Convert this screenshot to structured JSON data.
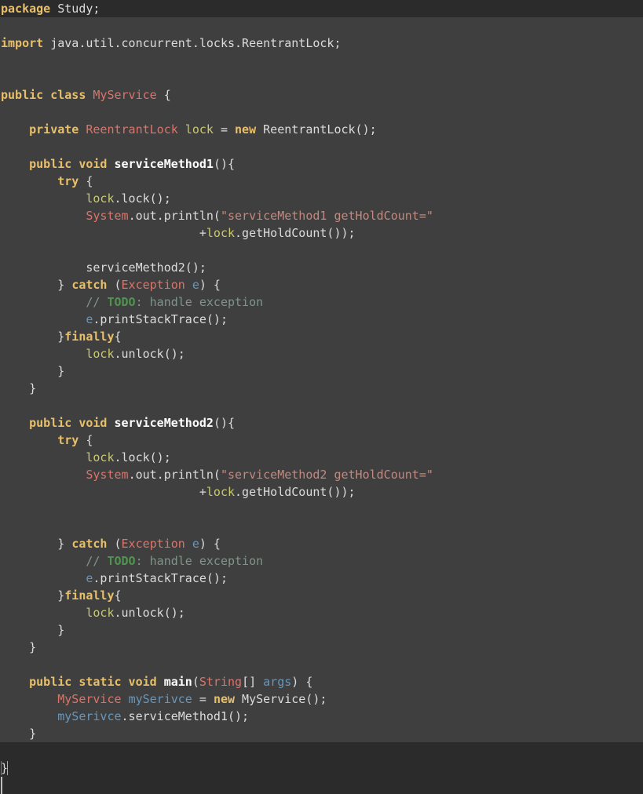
{
  "editor": {
    "language": "Java",
    "file_kind": "java-source",
    "colors": {
      "background": "#3f3f3f",
      "band": "#2b2b2b",
      "plain_text": "#dcdcdc",
      "keyword": "#e8bf6a",
      "class_name": "#d9756b",
      "string": "#c08a80",
      "field": "#c9c96e",
      "local_variable": "#6897bb",
      "method_declaration": "#ffffff",
      "comment": "#80958a",
      "todo_tag": "#519451",
      "caret": "#bfbfbf",
      "brace_match_left": "#3592c4",
      "brace_match_right": "#e8a33d"
    }
  },
  "code": {
    "lines": [
      {
        "id": "l1",
        "tokens": [
          {
            "t": "package",
            "c": "kw"
          },
          {
            "t": " Study;",
            "c": "pl"
          }
        ]
      },
      {
        "id": "l2",
        "tokens": []
      },
      {
        "id": "l3",
        "tokens": [
          {
            "t": "import",
            "c": "kw"
          },
          {
            "t": " java.util.concurrent.locks.ReentrantLock;",
            "c": "pl"
          }
        ]
      },
      {
        "id": "l4",
        "tokens": []
      },
      {
        "id": "l5",
        "tokens": []
      },
      {
        "id": "l6",
        "tokens": [
          {
            "t": "public class",
            "c": "kw"
          },
          {
            "t": " ",
            "c": "pl"
          },
          {
            "t": "MyService",
            "c": "cls"
          },
          {
            "t": " {",
            "c": "pl"
          }
        ]
      },
      {
        "id": "l7",
        "tokens": []
      },
      {
        "id": "l8",
        "tokens": [
          {
            "t": "    ",
            "c": "pl"
          },
          {
            "t": "private",
            "c": "kw"
          },
          {
            "t": " ",
            "c": "pl"
          },
          {
            "t": "ReentrantLock",
            "c": "cls"
          },
          {
            "t": " ",
            "c": "pl"
          },
          {
            "t": "lock",
            "c": "fld"
          },
          {
            "t": " = ",
            "c": "pl"
          },
          {
            "t": "new",
            "c": "kw"
          },
          {
            "t": " ReentrantLock();",
            "c": "pl"
          }
        ]
      },
      {
        "id": "l9",
        "tokens": []
      },
      {
        "id": "l10",
        "tokens": [
          {
            "t": "    ",
            "c": "pl"
          },
          {
            "t": "public void",
            "c": "kw"
          },
          {
            "t": " ",
            "c": "pl"
          },
          {
            "t": "serviceMethod1",
            "c": "mth"
          },
          {
            "t": "(){",
            "c": "pl"
          }
        ]
      },
      {
        "id": "l11",
        "tokens": [
          {
            "t": "        ",
            "c": "pl"
          },
          {
            "t": "try",
            "c": "kw"
          },
          {
            "t": " {",
            "c": "pl"
          }
        ]
      },
      {
        "id": "l12",
        "tokens": [
          {
            "t": "            ",
            "c": "pl"
          },
          {
            "t": "lock",
            "c": "fld"
          },
          {
            "t": ".lock();",
            "c": "pl"
          }
        ]
      },
      {
        "id": "l13",
        "tokens": [
          {
            "t": "            ",
            "c": "pl"
          },
          {
            "t": "System",
            "c": "cls"
          },
          {
            "t": ".out.println(",
            "c": "pl"
          },
          {
            "t": "\"serviceMethod1 getHoldCount=\"",
            "c": "str"
          }
        ]
      },
      {
        "id": "l14",
        "tokens": [
          {
            "t": "                            +",
            "c": "pl"
          },
          {
            "t": "lock",
            "c": "fld"
          },
          {
            "t": ".getHoldCount());",
            "c": "pl"
          }
        ]
      },
      {
        "id": "l15",
        "tokens": []
      },
      {
        "id": "l16",
        "tokens": [
          {
            "t": "            serviceMethod2();",
            "c": "pl"
          }
        ]
      },
      {
        "id": "l17",
        "tokens": [
          {
            "t": "        } ",
            "c": "pl"
          },
          {
            "t": "catch",
            "c": "kw"
          },
          {
            "t": " (",
            "c": "pl"
          },
          {
            "t": "Exception",
            "c": "cls"
          },
          {
            "t": " ",
            "c": "pl"
          },
          {
            "t": "e",
            "c": "var"
          },
          {
            "t": ") {",
            "c": "pl"
          }
        ]
      },
      {
        "id": "l18",
        "tokens": [
          {
            "t": "            ",
            "c": "pl"
          },
          {
            "t": "// ",
            "c": "cmt"
          },
          {
            "t": "TODO",
            "c": "todo"
          },
          {
            "t": ": handle exception",
            "c": "cmt"
          }
        ]
      },
      {
        "id": "l19",
        "tokens": [
          {
            "t": "            ",
            "c": "pl"
          },
          {
            "t": "e",
            "c": "var"
          },
          {
            "t": ".printStackTrace();",
            "c": "pl"
          }
        ]
      },
      {
        "id": "l20",
        "tokens": [
          {
            "t": "        }",
            "c": "pl"
          },
          {
            "t": "finally",
            "c": "kw"
          },
          {
            "t": "{",
            "c": "pl"
          }
        ]
      },
      {
        "id": "l21",
        "tokens": [
          {
            "t": "            ",
            "c": "pl"
          },
          {
            "t": "lock",
            "c": "fld"
          },
          {
            "t": ".unlock();",
            "c": "pl"
          }
        ]
      },
      {
        "id": "l22",
        "tokens": [
          {
            "t": "        }",
            "c": "pl"
          }
        ]
      },
      {
        "id": "l23",
        "tokens": [
          {
            "t": "    }",
            "c": "pl"
          }
        ]
      },
      {
        "id": "l24",
        "tokens": []
      },
      {
        "id": "l25",
        "tokens": [
          {
            "t": "    ",
            "c": "pl"
          },
          {
            "t": "public void",
            "c": "kw"
          },
          {
            "t": " ",
            "c": "pl"
          },
          {
            "t": "serviceMethod2",
            "c": "mth"
          },
          {
            "t": "(){",
            "c": "pl"
          }
        ]
      },
      {
        "id": "l26",
        "tokens": [
          {
            "t": "        ",
            "c": "pl"
          },
          {
            "t": "try",
            "c": "kw"
          },
          {
            "t": " {",
            "c": "pl"
          }
        ]
      },
      {
        "id": "l27",
        "tokens": [
          {
            "t": "            ",
            "c": "pl"
          },
          {
            "t": "lock",
            "c": "fld"
          },
          {
            "t": ".lock();",
            "c": "pl"
          }
        ]
      },
      {
        "id": "l28",
        "tokens": [
          {
            "t": "            ",
            "c": "pl"
          },
          {
            "t": "System",
            "c": "cls"
          },
          {
            "t": ".out.println(",
            "c": "pl"
          },
          {
            "t": "\"serviceMethod2 getHoldCount=\"",
            "c": "str"
          }
        ]
      },
      {
        "id": "l29",
        "tokens": [
          {
            "t": "                            +",
            "c": "pl"
          },
          {
            "t": "lock",
            "c": "fld"
          },
          {
            "t": ".getHoldCount());",
            "c": "pl"
          }
        ]
      },
      {
        "id": "l30",
        "tokens": []
      },
      {
        "id": "l31",
        "tokens": []
      },
      {
        "id": "l32",
        "tokens": [
          {
            "t": "        } ",
            "c": "pl"
          },
          {
            "t": "catch",
            "c": "kw"
          },
          {
            "t": " (",
            "c": "pl"
          },
          {
            "t": "Exception",
            "c": "cls"
          },
          {
            "t": " ",
            "c": "pl"
          },
          {
            "t": "e",
            "c": "var"
          },
          {
            "t": ") {",
            "c": "pl"
          }
        ]
      },
      {
        "id": "l33",
        "tokens": [
          {
            "t": "            ",
            "c": "pl"
          },
          {
            "t": "// ",
            "c": "cmt"
          },
          {
            "t": "TODO",
            "c": "todo"
          },
          {
            "t": ": handle exception",
            "c": "cmt"
          }
        ]
      },
      {
        "id": "l34",
        "tokens": [
          {
            "t": "            ",
            "c": "pl"
          },
          {
            "t": "e",
            "c": "var"
          },
          {
            "t": ".printStackTrace();",
            "c": "pl"
          }
        ]
      },
      {
        "id": "l35",
        "tokens": [
          {
            "t": "        }",
            "c": "pl"
          },
          {
            "t": "finally",
            "c": "kw"
          },
          {
            "t": "{",
            "c": "pl"
          }
        ]
      },
      {
        "id": "l36",
        "tokens": [
          {
            "t": "            ",
            "c": "pl"
          },
          {
            "t": "lock",
            "c": "fld"
          },
          {
            "t": ".unlock();",
            "c": "pl"
          }
        ]
      },
      {
        "id": "l37",
        "tokens": [
          {
            "t": "        }",
            "c": "pl"
          }
        ]
      },
      {
        "id": "l38",
        "tokens": [
          {
            "t": "    }",
            "c": "pl"
          }
        ]
      },
      {
        "id": "l39",
        "tokens": []
      },
      {
        "id": "l40",
        "tokens": [
          {
            "t": "    ",
            "c": "pl"
          },
          {
            "t": "public static void",
            "c": "kw"
          },
          {
            "t": " ",
            "c": "pl"
          },
          {
            "t": "main",
            "c": "mth"
          },
          {
            "t": "(",
            "c": "pl"
          },
          {
            "t": "String",
            "c": "cls"
          },
          {
            "t": "[] ",
            "c": "pl"
          },
          {
            "t": "args",
            "c": "var"
          },
          {
            "t": ") {",
            "c": "pl"
          }
        ]
      },
      {
        "id": "l41",
        "tokens": [
          {
            "t": "        ",
            "c": "pl"
          },
          {
            "t": "MyService",
            "c": "cls"
          },
          {
            "t": " ",
            "c": "pl"
          },
          {
            "t": "mySerivce",
            "c": "var"
          },
          {
            "t": " = ",
            "c": "pl"
          },
          {
            "t": "new",
            "c": "kw"
          },
          {
            "t": " MyService();",
            "c": "pl"
          }
        ]
      },
      {
        "id": "l42",
        "tokens": [
          {
            "t": "        ",
            "c": "pl"
          },
          {
            "t": "mySerivce",
            "c": "var"
          },
          {
            "t": ".serviceMethod1();",
            "c": "pl"
          }
        ]
      },
      {
        "id": "l43",
        "tokens": [
          {
            "t": "    }",
            "c": "pl"
          }
        ]
      },
      {
        "id": "l44",
        "tokens": []
      },
      {
        "id": "l45",
        "tokens": [
          {
            "t": "}",
            "c": "brace-match"
          }
        ]
      }
    ]
  },
  "caret": {
    "line": 46,
    "column": 1,
    "visible": true
  }
}
